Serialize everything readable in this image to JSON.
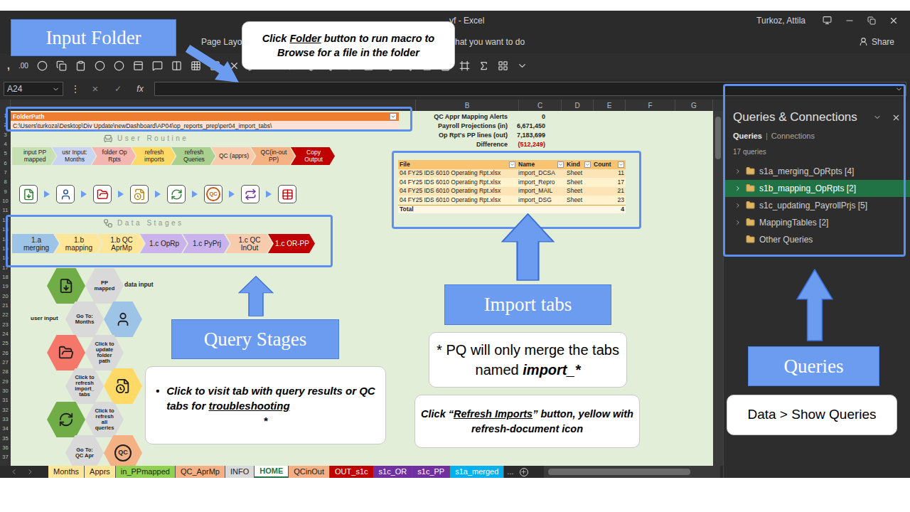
{
  "window": {
    "title": "yf  -  Excel",
    "user": "Turkoz, Attila"
  },
  "ribbon": {
    "tabs": [
      "Page Layou"
    ],
    "tell_me": "hat you want to do",
    "share": "Share"
  },
  "toolbar": {
    "comma": ",",
    "decimal": ".00"
  },
  "formula_bar": {
    "name_box": "A24",
    "menu": "⋮",
    "cancel": "×",
    "enter": "✓",
    "function": "fx",
    "value": ""
  },
  "columns": [
    "B",
    "C",
    "D",
    "E",
    "F",
    "G"
  ],
  "rows": [
    "1",
    "2",
    "3",
    "4",
    "5",
    "6",
    "7",
    "8",
    "9",
    "10",
    "11",
    "12",
    "13",
    "14",
    "15",
    "16",
    "17",
    "18",
    "19",
    "20",
    "21",
    "22",
    "23",
    "24",
    "25",
    "26",
    "27",
    "28",
    "29",
    "30",
    "31",
    "32",
    "33",
    "34",
    "35",
    "36",
    "37"
  ],
  "folder_path": {
    "header": "FolderPath",
    "value": "C:\\Users\\turkoza\\Desktop\\Div Update\\newDashboard\\AP04\\op_reports_prep\\per04_import_tabs\\"
  },
  "metrics": [
    {
      "label": "QC Appr Mapping Alerts",
      "value": "0",
      "negative": false
    },
    {
      "label": "Payroll Projections (in)",
      "value": "6,671,450",
      "negative": false
    },
    {
      "label": "Op Rpt's PP lines (out)",
      "value": "7,183,699",
      "negative": false
    },
    {
      "label": "Difference",
      "value": "(512,249)",
      "negative": true
    }
  ],
  "user_routine": {
    "title": "User Routine",
    "steps": [
      {
        "label": "input PP mapped",
        "color": "#c6e0b4"
      },
      {
        "label": "usr Input: Months",
        "color": "#c9d4f0"
      },
      {
        "label": "folder Op Rpts",
        "color": "#f4b6b0"
      },
      {
        "label": "refresh imports",
        "color": "#ffd966"
      },
      {
        "label": "refresh Queries",
        "color": "#a9d08e"
      },
      {
        "label": "QC (apprs)",
        "color": "#f8cbad"
      },
      {
        "label": "QC(in-out PP)",
        "color": "#f4b183"
      },
      {
        "label": "Copy Output",
        "color": "#c00000"
      }
    ]
  },
  "routine_icons": [
    {
      "kind": "icon"
    },
    {
      "kind": "icon"
    },
    {
      "kind": "icon"
    },
    {
      "kind": "icon"
    },
    {
      "kind": "icon"
    },
    {
      "kind": "badge",
      "label": "QC"
    },
    {
      "kind": "icon"
    },
    {
      "kind": "icon"
    }
  ],
  "data_stages": {
    "title": "Data Stages",
    "stages": [
      {
        "label": "1.a merging",
        "color": "#9dc3e6"
      },
      {
        "label": "1.b mapping",
        "color": "#ffe699"
      },
      {
        "label": "1.b QC AprMp",
        "color": "#ffe699"
      },
      {
        "label": "1.c OpRp",
        "color": "#c9b3ea"
      },
      {
        "label": "1.c PyPrj",
        "color": "#c9b3ea"
      },
      {
        "label": "1.c QC InOut",
        "color": "#f8cbad"
      },
      {
        "label": "1.c OR-PP",
        "color": "#c00000"
      }
    ]
  },
  "hexes": [
    {
      "kind": "icon",
      "color": "#70ad47",
      "label": ""
    },
    {
      "kind": "label",
      "color": "#d9d9d9",
      "label": "PP mapped"
    },
    {
      "kind": "label",
      "color": "#d9d9d9",
      "label": "Go To: Months"
    },
    {
      "kind": "icon",
      "color": "#9dc3e6",
      "label": ""
    },
    {
      "kind": "icon",
      "color": "#f4776a",
      "label": ""
    },
    {
      "kind": "label",
      "color": "#d9d9d9",
      "label": "Click to update folder path"
    },
    {
      "kind": "label",
      "color": "#d9d9d9",
      "label": "Click to refresh import_ tabs"
    },
    {
      "kind": "icon",
      "color": "#ffd966",
      "label": ""
    },
    {
      "kind": "icon",
      "color": "#70ad47",
      "label": ""
    },
    {
      "kind": "label",
      "color": "#d9d9d9",
      "label": "Click to refresh all queries"
    },
    {
      "kind": "label",
      "color": "#d9d9d9",
      "label": "Go To: QC Apr"
    },
    {
      "kind": "badge",
      "color": "#f4b183",
      "label": "QC"
    }
  ],
  "hex_notes": {
    "data": "data input",
    "user": "user input"
  },
  "import_table": {
    "columns": [
      "File",
      "Name",
      "Kind",
      "Count"
    ],
    "rows": [
      [
        "04 FY25 IDS 6010 Operating Rpt.xlsx",
        "import_DCSA",
        "Sheet",
        "11"
      ],
      [
        "04 FY25 IDS 6010 Operating Rpt.xlsx",
        "import_Repro",
        "Sheet",
        "17"
      ],
      [
        "04 FY25 IDS 6010 Operating Rpt.xlsx",
        "import_MAIL",
        "Sheet",
        "21"
      ],
      [
        "04 FY25 IDS 6010 Operating Rpt.xlsx",
        "import_DSG",
        "Sheet",
        "23"
      ]
    ],
    "total": {
      "label": "Total",
      "count": "4"
    }
  },
  "sheet_tabs": [
    {
      "label": "Months",
      "color": "#ffe699",
      "selected": false
    },
    {
      "label": "Apprs",
      "color": "#ffe699",
      "selected": false
    },
    {
      "label": "in_PPmapped",
      "color": "#92d050",
      "selected": false
    },
    {
      "label": "QC_AprMp",
      "color": "#f4b084",
      "selected": false
    },
    {
      "label": "INFO",
      "color": "#d9d9d9",
      "selected": false
    },
    {
      "label": "HOME",
      "color": "#ffffff",
      "selected": true
    },
    {
      "label": "QCinOut",
      "color": "#f4b084",
      "selected": false
    },
    {
      "label": "OUT_s1c",
      "color": "#c00000",
      "selected": false
    },
    {
      "label": "s1c_OR",
      "color": "#7030a0",
      "selected": false
    },
    {
      "label": "s1c_PP",
      "color": "#7030a0",
      "selected": false
    },
    {
      "label": "s1a_merged",
      "color": "#00b0f0",
      "selected": false
    }
  ],
  "sheet_tabs_more": "...",
  "queries_pane": {
    "title": "Queries & Connections",
    "tabs": [
      {
        "label": "Queries",
        "selected": true
      },
      {
        "label": "Connections",
        "selected": false
      }
    ],
    "separator": "|",
    "count": "17 queries",
    "groups": [
      {
        "label": "s1a_merging_OpRpts [4]",
        "expandable": true,
        "selected": false
      },
      {
        "label": "s1b_mapping_OpRpts [2]",
        "expandable": true,
        "selected": true
      },
      {
        "label": "s1c_updating_PayrollPrjs [5]",
        "expandable": true,
        "selected": false
      },
      {
        "label": "MappingTables [2]",
        "expandable": true,
        "selected": false
      },
      {
        "label": "Other Queries",
        "expandable": false,
        "selected": false
      }
    ]
  },
  "annotations": {
    "input_folder": "Input Folder",
    "folder_hint": [
      "Click ",
      "Folder",
      " button to run macro to Browse for a file in the folder"
    ],
    "query_stages": "Query Stages",
    "stages_hint": {
      "bullet": "•",
      "parts": [
        "Click to visit tab with query results or QC tabs for ",
        "troubleshooting"
      ],
      "footnote": "*"
    },
    "import_tabs": "Import tabs",
    "pq_note": [
      "* PQ will only merge the tabs named ",
      "import_*"
    ],
    "refresh_hint": [
      "Click “",
      "Refresh Imports",
      "” button, yellow with refresh-document icon"
    ],
    "queries": "Queries",
    "queries_hint": "Data > Show Queries"
  }
}
